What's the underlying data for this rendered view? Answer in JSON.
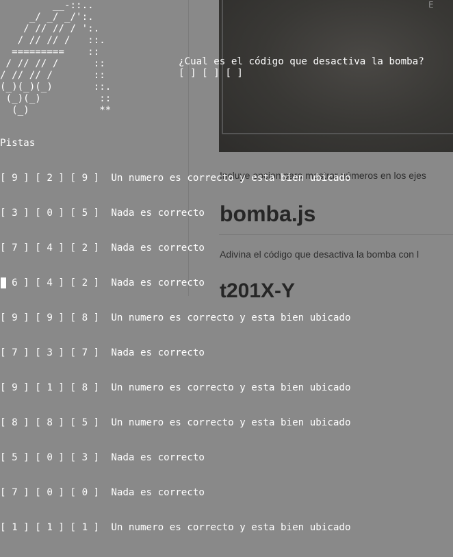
{
  "background_page": {
    "description_1": "Incluye opcion para mostrar números en los ejes",
    "title_1": "bomba.js",
    "description_2": "Adivina el código que desactiva la bomba con l",
    "title_2": "t201X-Y",
    "image_corner_text": "E"
  },
  "terminal": {
    "ascii_art": "         __-::..\n     _/ _/ _/':.\n    / // // / ':.\n   / // // /   ::.\n  =========    ::\n / // // /      ::\n/ // // /       ::\n(_)(_)(_)       ::.\n (_)(_)          ::\n  (_)            **",
    "question": "¿Cual es el código que desactiva la bomba?",
    "code_slots": "[ ] [ ] [ ]",
    "hints_label": "Pistas",
    "hints": [
      {
        "digits": "[ 9 ] [ 2 ] [ 9 ]",
        "message": "Un numero es correcto y esta bien ubicado"
      },
      {
        "digits": "[ 3 ] [ 0 ] [ 5 ]",
        "message": "Nada es correcto"
      },
      {
        "digits": "[ 7 ] [ 4 ] [ 2 ]",
        "message": "Nada es correcto"
      },
      {
        "digits": "[ 6 ] [ 4 ] [ 2 ]",
        "message": "Nada es correcto"
      },
      {
        "digits": "[ 9 ] [ 9 ] [ 8 ]",
        "message": "Un numero es correcto y esta bien ubicado"
      },
      {
        "digits": "[ 7 ] [ 3 ] [ 7 ]",
        "message": "Nada es correcto"
      },
      {
        "digits": "[ 9 ] [ 1 ] [ 8 ]",
        "message": "Un numero es correcto y esta bien ubicado"
      },
      {
        "digits": "[ 8 ] [ 8 ] [ 5 ]",
        "message": "Un numero es correcto y esta bien ubicado"
      },
      {
        "digits": "[ 5 ] [ 0 ] [ 3 ]",
        "message": "Nada es correcto"
      },
      {
        "digits": "[ 7 ] [ 0 ] [ 0 ]",
        "message": "Nada es correcto"
      },
      {
        "digits": "[ 1 ] [ 1 ] [ 1 ]",
        "message": "Un numero es correcto y esta bien ubicado"
      }
    ],
    "colors": {
      "text": "#ffffff",
      "overlay_background": "#898989"
    }
  }
}
